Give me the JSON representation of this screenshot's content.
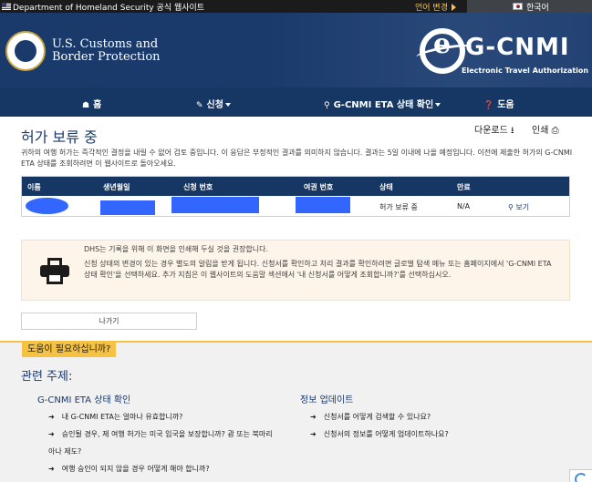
{
  "topbar": {
    "gov_label": "Department of Homeland Security 공식 웹사이트",
    "lang_change": "언어 변경",
    "current_lang": "한국어"
  },
  "header": {
    "agency_line1": "U.S. Customs and",
    "agency_line2": "Border Protection",
    "brand": "G-CNMI",
    "brand_sub": "Electronic Travel Authorization"
  },
  "nav": {
    "home": "홈",
    "apply": "신청",
    "status": "G-CNMI ETA 상태 확인",
    "help": "도움"
  },
  "page": {
    "title": "허가 보류 중",
    "download": "다운로드",
    "print": "인쇄",
    "description": "귀하의 여행 허가는 즉각적인 결정을 내릴 수 없어 검토 중입니다. 이 응답은 부정적인 결과를 의미하지 않습니다. 결과는 5일 이내에 나올 예정입니다. 이전에 제출한 허가의 G-CNMI ETA 상태를 조회하려면 이 웹사이트로 돌아오세요."
  },
  "table": {
    "headers": [
      "이름",
      "생년월일",
      "신청 번호",
      "여권 번호",
      "상태",
      "만료"
    ],
    "row": {
      "status": "허가 보류 중",
      "expiry": "N/A",
      "view": "보기"
    }
  },
  "notice": {
    "line1": "DHS는 기록을 위해 이 화면을 인쇄해 두실 것을 권장합니다.",
    "line2": "신청 상태의 변경이 있는 경우 별도의 알림을 받게 됩니다. 신청서를 확인하고 처리 결과를 확인하려면 글로벌 탐색 메뉴 또는 홈페이지에서 'G-CNMI ETA 상태 확인'을 선택하세요. 추가 지침은 이 웹사이트의 도움말 섹션에서 '내 신청서를 어떻게 조회합니까?'를 선택하십시오."
  },
  "exit_button": "나가기",
  "help": {
    "tag": "도움이 필요하십니까?",
    "related": "관련 주제:",
    "col1_title": "G-CNMI ETA 상태 확인",
    "col1_links": [
      "내 G-CNMI ETA는 얼마나 유효합니까?",
      "승인될 경우, 제 여행 허가는 미국 입국을 보장합니까? 괌 또는 북마리",
      "여행 승인이 되지 않을 경우 어떻게 해야 합니까?"
    ],
    "col1_wrap": "아나 제도?",
    "col2_title": "정보 업데이트",
    "col2_links": [
      "신청서를 어떻게 검색할 수 있나요?",
      "신청서의 정보를 어떻게 업데이트하나요?"
    ]
  },
  "colors": {
    "navy": "#163763",
    "header_blue": "#1a3a6b",
    "gold": "#f6c244",
    "redaction": "#3366ff",
    "notice_bg": "#fdf5e9"
  }
}
